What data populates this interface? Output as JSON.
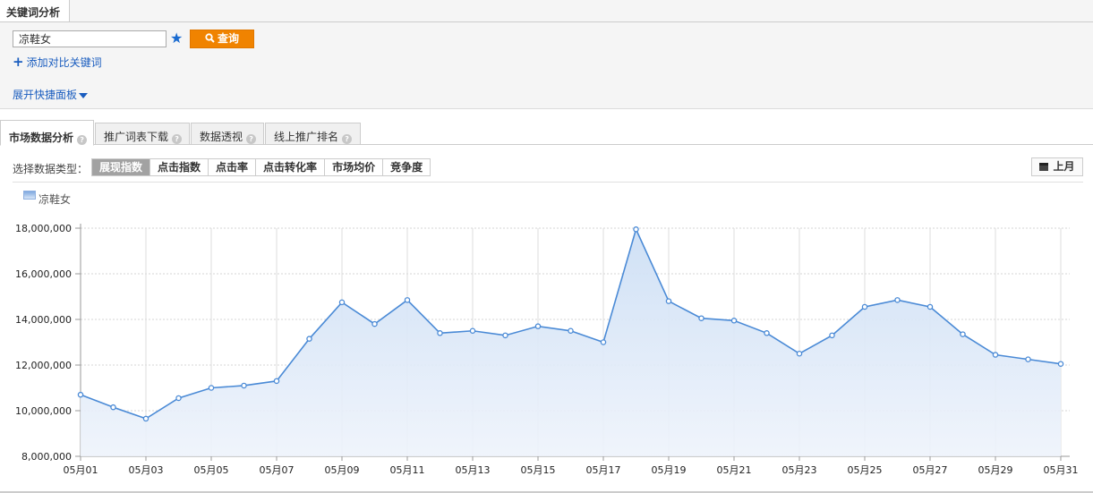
{
  "header": {
    "tab_title": "关键词分析",
    "keyword_value": "凉鞋女",
    "search_label": "查询",
    "add_compare_label": "添加对比关键词",
    "expand_label": "展开快捷面板"
  },
  "tabs": [
    {
      "label": "市场数据分析",
      "active": true
    },
    {
      "label": "推广词表下载",
      "active": false
    },
    {
      "label": "数据透视",
      "active": false
    },
    {
      "label": "线上推广排名",
      "active": false
    }
  ],
  "type_selector": {
    "label": "选择数据类型：",
    "options": [
      "展现指数",
      "点击指数",
      "点击率",
      "点击转化率",
      "市场均价",
      "竞争度"
    ],
    "selected": "展现指数"
  },
  "period_button": "上月",
  "icons": {
    "star": "star-icon",
    "search": "search-icon",
    "plus": "plus-icon",
    "expand": "chevron-down-icon",
    "help": "question-icon",
    "calendar": "calendar-icon"
  },
  "colors": {
    "accent": "#f08300",
    "link": "#1a5dbf",
    "series_line": "#4a8ad6",
    "series_fill": "#cddff5"
  },
  "chart_data": {
    "type": "area",
    "title": "",
    "xlabel": "",
    "ylabel": "",
    "legend": {
      "placement": "top-left"
    },
    "grid": true,
    "ylim": [
      8000000,
      18000000
    ],
    "y_ticks": [
      8000000,
      10000000,
      12000000,
      14000000,
      16000000,
      18000000
    ],
    "y_tick_labels": [
      "8,000,000",
      "10,000,000",
      "12,000,000",
      "14,000,000",
      "16,000,000",
      "18,000,000"
    ],
    "x": [
      "05月01",
      "05月02",
      "05月03",
      "05月04",
      "05月05",
      "05月06",
      "05月07",
      "05月08",
      "05月09",
      "05月10",
      "05月11",
      "05月12",
      "05月13",
      "05月14",
      "05月15",
      "05月16",
      "05月17",
      "05月18",
      "05月19",
      "05月20",
      "05月21",
      "05月22",
      "05月23",
      "05月24",
      "05月25",
      "05月26",
      "05月27",
      "05月28",
      "05月29",
      "05月30",
      "05月31"
    ],
    "x_tick_labels": [
      "05月01",
      "05月03",
      "05月05",
      "05月07",
      "05月09",
      "05月11",
      "05月13",
      "05月15",
      "05月17",
      "05月19",
      "05月21",
      "05月23",
      "05月25",
      "05月27",
      "05月29",
      "05月31"
    ],
    "series": [
      {
        "name": "凉鞋女",
        "values": [
          10700000,
          10150000,
          9650000,
          10550000,
          11000000,
          11100000,
          11300000,
          13150000,
          14750000,
          13800000,
          14850000,
          13400000,
          13500000,
          13300000,
          13700000,
          13500000,
          13000000,
          17950000,
          14800000,
          14050000,
          13950000,
          13400000,
          12500000,
          13300000,
          14550000,
          14850000,
          14550000,
          13350000,
          12450000,
          12250000,
          12050000
        ]
      }
    ]
  }
}
